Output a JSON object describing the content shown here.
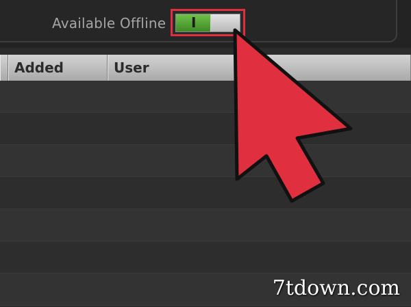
{
  "toolbar": {
    "offline_label": "Available Offline",
    "toggle": {
      "state": "on",
      "on_glyph": "I"
    }
  },
  "table": {
    "columns": [
      "Added",
      "User"
    ]
  },
  "colors": {
    "highlight": "#e0303d",
    "cursor_fill": "#e02f3e",
    "toggle_on": "#5aa83a"
  },
  "cursor_icon": "arrow-pointer-icon",
  "watermark": "7tdown.com"
}
